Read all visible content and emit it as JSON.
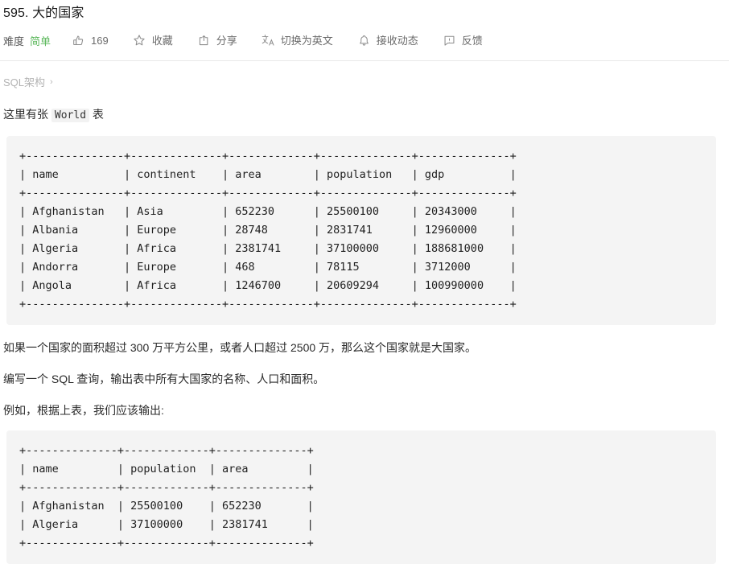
{
  "header": {
    "title": "595. 大的国家"
  },
  "toolbar": {
    "difficulty_label": "难度",
    "difficulty_value": "简单",
    "difficulty_color": "#5cb85c",
    "items": [
      {
        "icon": "thumbs-up-icon",
        "label": "169",
        "name": "likes"
      },
      {
        "icon": "star-icon",
        "label": "收藏",
        "name": "favorite"
      },
      {
        "icon": "share-icon",
        "label": "分享",
        "name": "share"
      },
      {
        "icon": "translate-icon",
        "label": "切换为英文",
        "name": "switch-language"
      },
      {
        "icon": "bell-icon",
        "label": "接收动态",
        "name": "subscribe"
      },
      {
        "icon": "feedback-icon",
        "label": "反馈",
        "name": "feedback"
      }
    ]
  },
  "breadcrumb": {
    "label": "SQL架构",
    "separator": "›"
  },
  "content": {
    "intro_prefix": "这里有张 ",
    "intro_code": "World",
    "intro_suffix": " 表",
    "paragraph_1": "如果一个国家的面积超过 300 万平方公里，或者人口超过 2500 万，那么这个国家就是大国家。",
    "paragraph_2": "编写一个 SQL 查询，输出表中所有大国家的名称、人口和面积。",
    "paragraph_3": "例如，根据上表，我们应该输出:"
  },
  "table_world": {
    "columns": [
      "name",
      "continent",
      "area",
      "population",
      "gdp"
    ],
    "rows": [
      [
        "Afghanistan",
        "Asia",
        "652230",
        "25500100",
        "20343000"
      ],
      [
        "Albania",
        "Europe",
        "28748",
        "2831741",
        "12960000"
      ],
      [
        "Algeria",
        "Africa",
        "2381741",
        "37100000",
        "188681000"
      ],
      [
        "Andorra",
        "Europe",
        "468",
        "78115",
        "3712000"
      ],
      [
        "Angola",
        "Africa",
        "1246700",
        "20609294",
        "100990000"
      ]
    ],
    "ascii": "+---------------+--------------+-------------+--------------+--------------+\n| name          | continent    | area        | population   | gdp          |\n+---------------+--------------+-------------+--------------+--------------+\n| Afghanistan   | Asia         | 652230      | 25500100     | 20343000     |\n| Albania       | Europe       | 28748       | 2831741      | 12960000     |\n| Algeria       | Africa       | 2381741     | 37100000     | 188681000    |\n| Andorra       | Europe       | 468         | 78115        | 3712000      |\n| Angola        | Africa       | 1246700     | 20609294     | 100990000    |\n+---------------+--------------+-------------+--------------+--------------+"
  },
  "table_output": {
    "columns": [
      "name",
      "population",
      "area"
    ],
    "rows": [
      [
        "Afghanistan",
        "25500100",
        "652230"
      ],
      [
        "Algeria",
        "37100000",
        "2381741"
      ]
    ],
    "ascii": "+--------------+-------------+--------------+\n| name         | population  | area         |\n+--------------+-------------+--------------+\n| Afghanistan  | 25500100    | 652230       |\n| Algeria      | 37100000    | 2381741      |\n+--------------+-------------+--------------+"
  }
}
